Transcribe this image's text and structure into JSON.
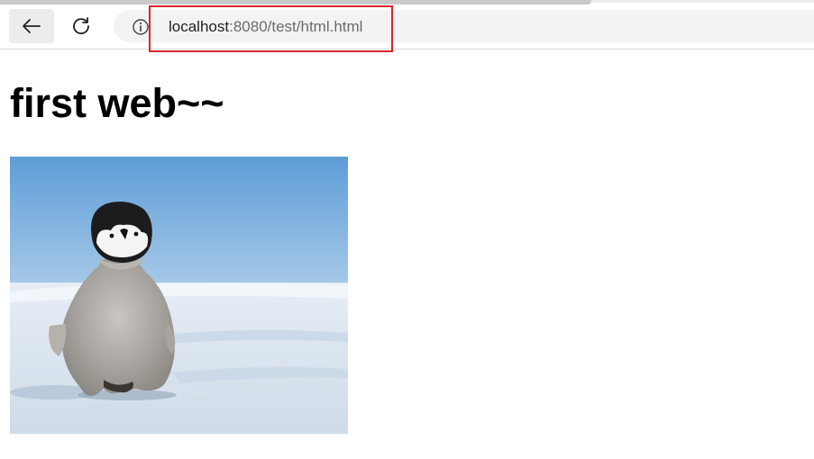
{
  "browser": {
    "address": {
      "host": "localhost",
      "path": ":8080/test/html.html"
    },
    "icons": {
      "back": "arrow-left-icon",
      "reload": "reload-icon",
      "info": "info-icon"
    }
  },
  "page": {
    "heading": "first web~~",
    "image": {
      "subject": "penguin-chick-on-snow"
    }
  },
  "colors": {
    "highlight_border": "#d9262b",
    "sky_top": "#5f9dd8",
    "snow": "#e9eef4"
  }
}
